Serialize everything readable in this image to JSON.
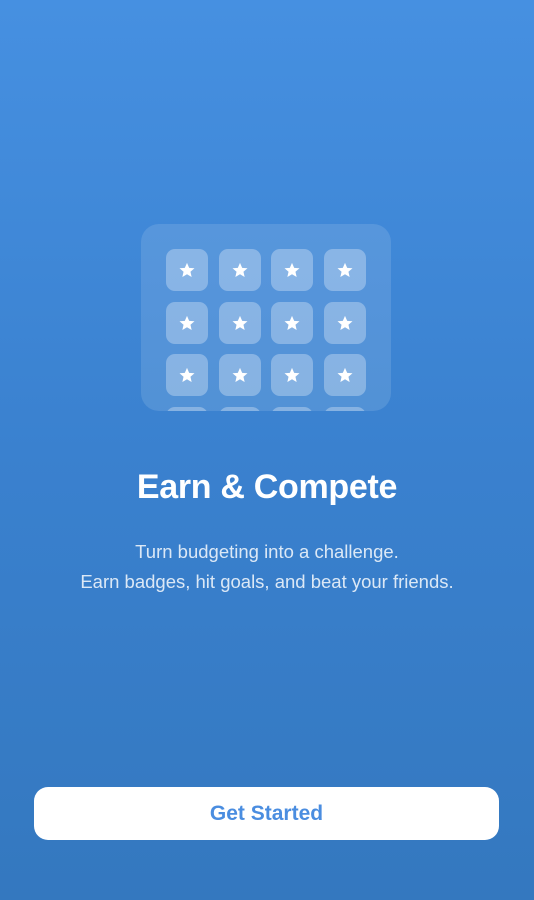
{
  "onboarding": {
    "badge_icon": "star-icon",
    "badge_count": 16,
    "title": "Earn & Compete",
    "subtitle_lines": [
      "Turn budgeting into a challenge.",
      "Earn badges, hit goals, and beat your friends."
    ],
    "cta_label": "Get Started"
  },
  "colors": {
    "background_top": "#4690e1",
    "background_bottom": "#3478bf",
    "button_background": "#ffffff",
    "button_text": "#4a8de0",
    "title_text": "#ffffff"
  }
}
